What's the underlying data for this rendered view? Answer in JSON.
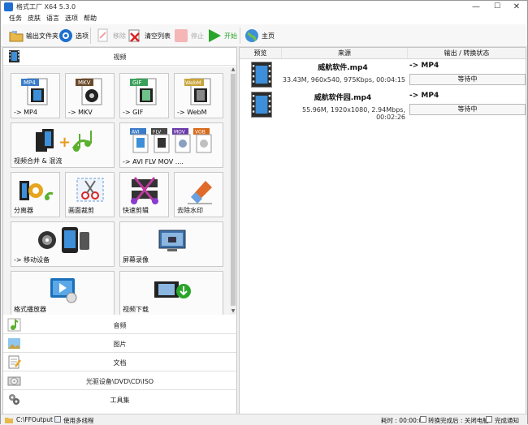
{
  "window": {
    "title": "格式工厂 X64 5.3.0",
    "minimize": "—",
    "maximize": "☐",
    "close": "✕"
  },
  "menu": [
    "任务",
    "皮肤",
    "语言",
    "选项",
    "帮助"
  ],
  "toolbar": {
    "output_folder": "输出文件夹",
    "options": "选项",
    "remove": "移除",
    "clear_list": "清空列表",
    "stop": "停止",
    "start": "开始",
    "home": "主页"
  },
  "categories": {
    "video": "视频",
    "audio": "音频",
    "image": "图片",
    "document": "文档",
    "rom": "光驱设备\\DVD\\CD\\ISO",
    "tools": "工具集"
  },
  "tiles": {
    "mp4": "-> MP4",
    "mkv": "-> MKV",
    "gif": "-> GIF",
    "webm": "-> WebM",
    "merge": "视频合并 & 混流",
    "avi": "-> AVI FLV MOV ....",
    "splitter": "分离器",
    "crop": "画面裁剪",
    "quick_clip": "快速剪辑",
    "watermark": "去除水印",
    "mobile": "-> 移动设备",
    "screen_rec": "屏幕录像",
    "player": "格式播放器",
    "download": "视频下载",
    "badge_mp4": "MP4",
    "badge_mkv": "MKV",
    "badge_gif": "GIF",
    "badge_webm": "WebM",
    "badge_avi": "AVI",
    "badge_flv": "FLV",
    "badge_mov": "MOV",
    "badge_vob": "VOB"
  },
  "list": {
    "headers": [
      "预览",
      "来源",
      "输出 / 转换状态"
    ],
    "rows": [
      {
        "name": "威航软件.mp4",
        "info": "33.43M, 960x540, 975Kbps, 00:04:15",
        "format": "-> MP4",
        "status": "等待中"
      },
      {
        "name": "威航软件园.mp4",
        "info": "55.96M, 1920x1080, 2.94Mbps, 00:02:26",
        "format": "-> MP4",
        "status": "等待中"
      }
    ]
  },
  "status": {
    "output_path": "C:\\FFOutput",
    "multithread": "使用多线程",
    "elapsed": "耗时 : 00:00:00",
    "after_convert": "转换完成后 : 关闭电脑",
    "notify": "完成通知"
  },
  "colors": {
    "accent_blue": "#1e6fd0",
    "start_green": "#2aa52a",
    "film_blue": "#1a6fb8"
  }
}
